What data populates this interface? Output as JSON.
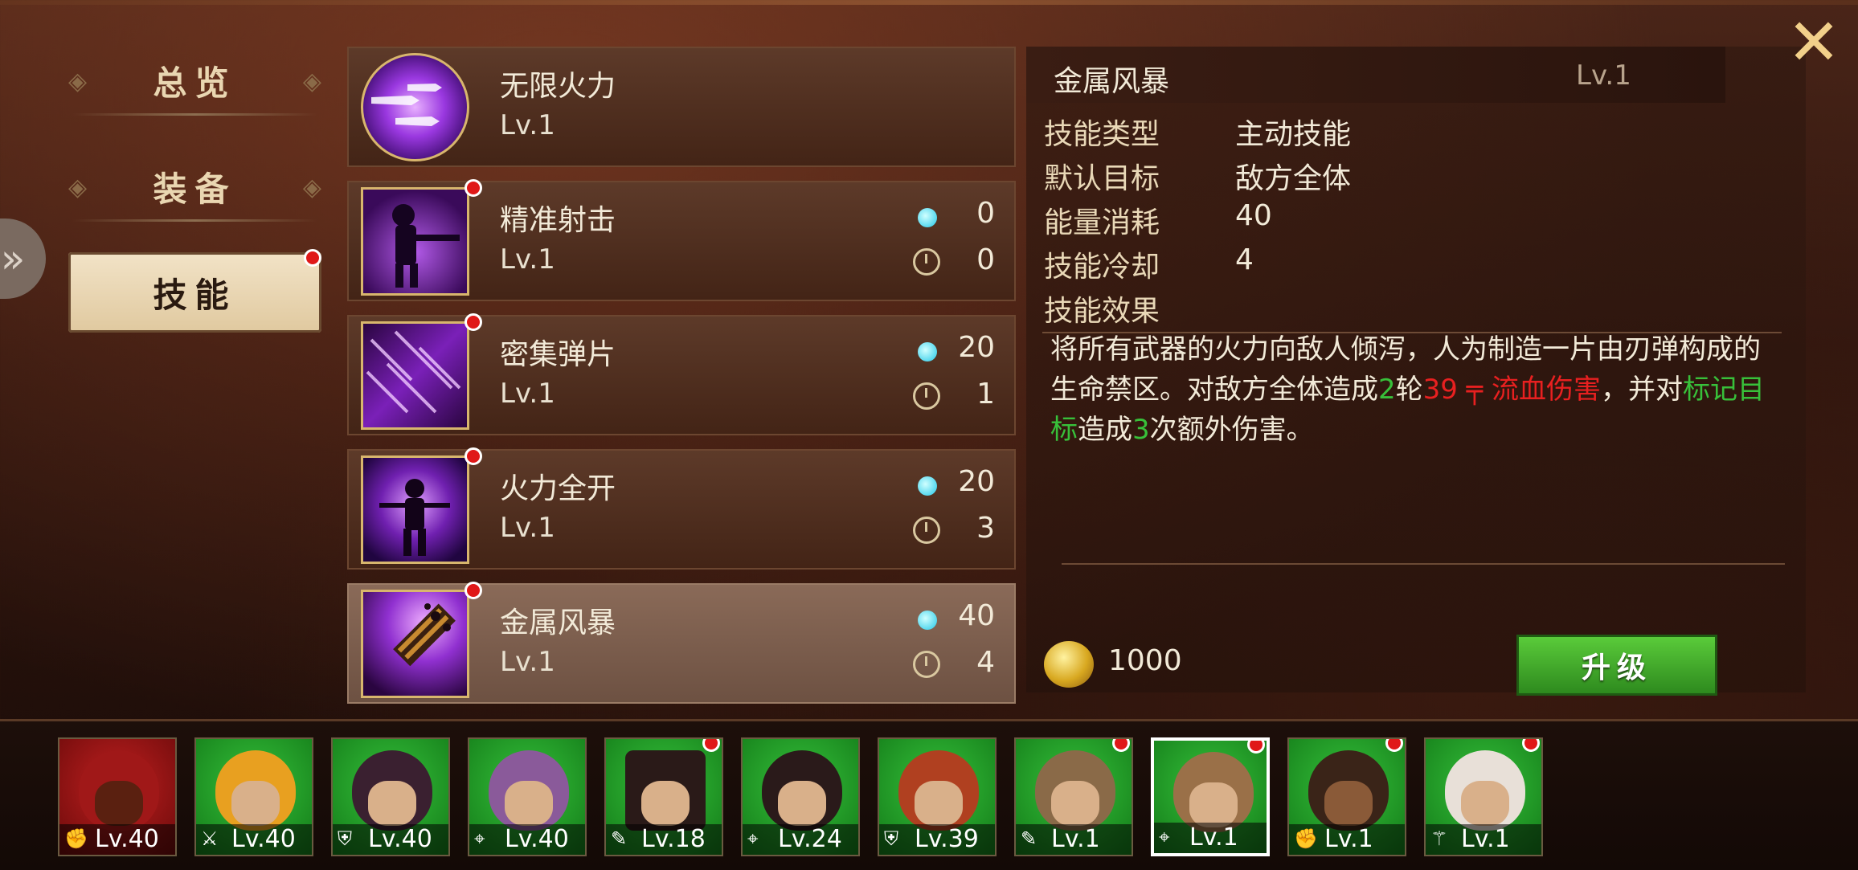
{
  "nav": {
    "items": [
      {
        "label": "总览"
      },
      {
        "label": "装备"
      },
      {
        "label": "技能"
      }
    ]
  },
  "skills": [
    {
      "name": "无限火力",
      "level": "Lv.1",
      "energy": "",
      "cooldown": ""
    },
    {
      "name": "精准射击",
      "level": "Lv.1",
      "energy": "0",
      "cooldown": "0"
    },
    {
      "name": "密集弹片",
      "level": "Lv.1",
      "energy": "20",
      "cooldown": "1"
    },
    {
      "name": "火力全开",
      "level": "Lv.1",
      "energy": "20",
      "cooldown": "3"
    },
    {
      "name": "金属风暴",
      "level": "Lv.1",
      "energy": "40",
      "cooldown": "4"
    }
  ],
  "detail": {
    "title": "金属风暴",
    "level": "Lv.1",
    "rows": [
      {
        "label": "技能类型",
        "value": "主动技能"
      },
      {
        "label": "默认目标",
        "value": "敌方全体"
      },
      {
        "label": "能量消耗",
        "value": "40"
      },
      {
        "label": "技能冷却",
        "value": "4"
      }
    ],
    "effect_label": "技能效果",
    "desc": {
      "p1": "将所有武器的火力向敌人倾泻，人为制造一片由刃弹构成的生命禁区。对敌方全体造成",
      "rounds": "2",
      "p2": "轮",
      "dmg": "39",
      "bleed": "流血伤害",
      "p3": "，并对",
      "mark": "标记目标",
      "p4": "造成",
      "times": "3",
      "p5": "次额外伤害。"
    },
    "gold": "1000",
    "upgrade_label": "升级"
  },
  "colors": {
    "green": "#38c03a",
    "red": "#e82020",
    "selected_skill_bg": "#8a6a58"
  },
  "roster": [
    {
      "level": "Lv.40",
      "class_icon": "fist-icon",
      "bg": "red",
      "dot": false,
      "selected": false
    },
    {
      "level": "Lv.40",
      "class_icon": "sword-icon",
      "bg": "green",
      "dot": false,
      "selected": false
    },
    {
      "level": "Lv.40",
      "class_icon": "shield-icon",
      "bg": "green",
      "dot": false,
      "selected": false
    },
    {
      "level": "Lv.40",
      "class_icon": "crosshair-icon",
      "bg": "green",
      "dot": false,
      "selected": false
    },
    {
      "level": "Lv.18",
      "class_icon": "pen-icon",
      "bg": "green",
      "dot": true,
      "selected": false
    },
    {
      "level": "Lv.24",
      "class_icon": "crosshair-icon",
      "bg": "green",
      "dot": false,
      "selected": false
    },
    {
      "level": "Lv.39",
      "class_icon": "shield-icon",
      "bg": "green",
      "dot": false,
      "selected": false
    },
    {
      "level": "Lv.1",
      "class_icon": "pen-icon",
      "bg": "green",
      "dot": true,
      "selected": false
    },
    {
      "level": "Lv.1",
      "class_icon": "crosshair-icon",
      "bg": "green",
      "dot": true,
      "selected": true
    },
    {
      "level": "Lv.1",
      "class_icon": "fist-icon",
      "bg": "green",
      "dot": true,
      "selected": false
    },
    {
      "level": "Lv.1",
      "class_icon": "wand-icon",
      "bg": "green",
      "dot": true,
      "selected": false
    }
  ]
}
